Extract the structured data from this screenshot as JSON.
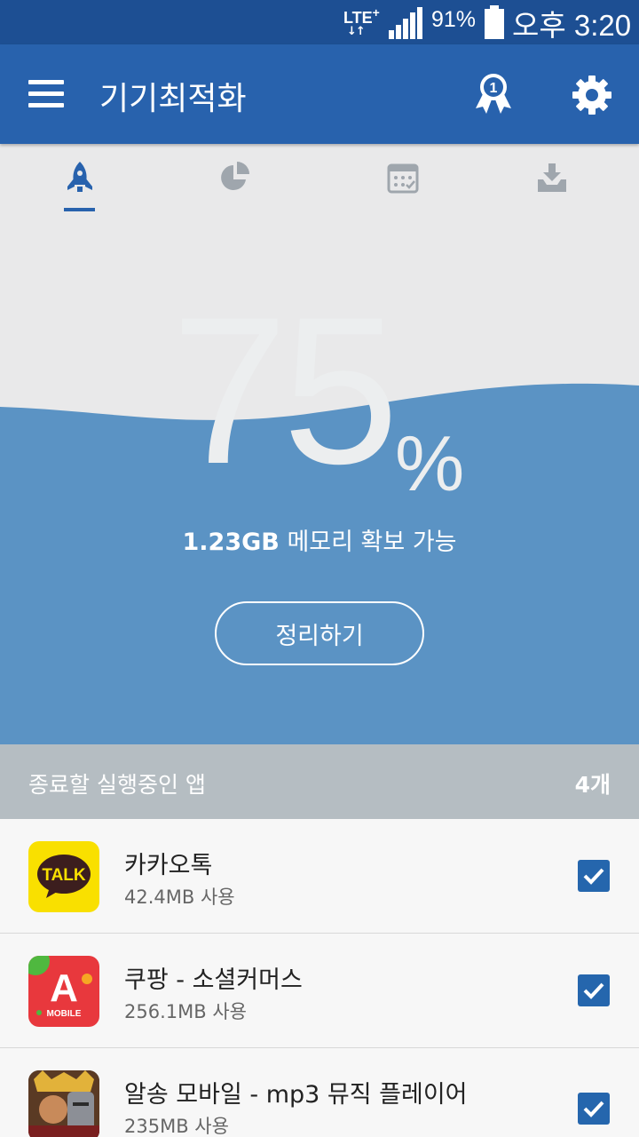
{
  "status_bar": {
    "network": "LTE",
    "network_plus": "+",
    "data_arrows": "↓↑",
    "battery_percent": "91%",
    "battery_level": 0.91,
    "time": "오후 3:20"
  },
  "app_bar": {
    "title": "기기최적화",
    "award_badge_number": "1",
    "icons": [
      "menu-icon",
      "award-icon",
      "settings-icon"
    ]
  },
  "tabs": [
    {
      "icon": "rocket-icon",
      "active": true
    },
    {
      "icon": "pie-chart-icon",
      "active": false
    },
    {
      "icon": "calendar-icon",
      "active": false
    },
    {
      "icon": "download-tray-icon",
      "active": false
    }
  ],
  "hero": {
    "percent_value": "75",
    "percent_sign": "%",
    "fill_level": 0.75,
    "free_amount": "1.23GB",
    "free_text": "메모리 확보 가능",
    "clean_button_label": "정리하기"
  },
  "running_apps": {
    "title": "종료할 실행중인 앱",
    "count": "4개",
    "items": [
      {
        "name": "카카오톡",
        "usage": "42.4MB 사용",
        "checked": true,
        "icon": "kakaotalk-icon",
        "icon_text": "TALK"
      },
      {
        "name": "쿠팡 - 소셜커머스",
        "usage": "256.1MB 사용",
        "checked": true,
        "icon": "coupang-icon",
        "icon_text": "A",
        "icon_subtext": "MOBILE"
      },
      {
        "name": "알송 모바일 - mp3 뮤직 플레이어",
        "usage": "235MB 사용",
        "checked": true,
        "icon": "alsong-icon"
      }
    ]
  },
  "colors": {
    "status_bar": "#1d4f93",
    "app_bar": "#2862ad",
    "wave": "#5b93c4",
    "list_header": "#b5bdc2",
    "checkbox": "#2566ad",
    "kakao_yellow": "#f9e000",
    "coupang_red": "#e8383d"
  }
}
